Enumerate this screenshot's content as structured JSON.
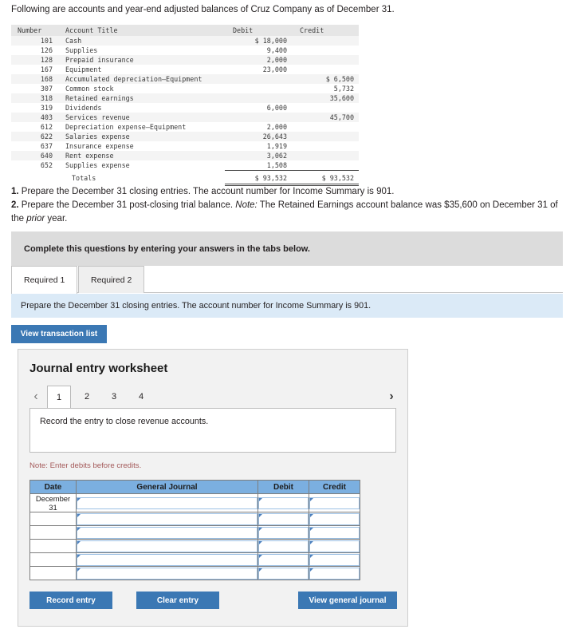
{
  "intro": "Following are accounts and year-end adjusted balances of Cruz Company as of December 31.",
  "trial_balance": {
    "headers": [
      "Number",
      "Account Title",
      "Debit",
      "Credit"
    ],
    "rows": [
      {
        "number": "101",
        "title": "Cash",
        "debit": "$ 18,000",
        "credit": ""
      },
      {
        "number": "126",
        "title": "Supplies",
        "debit": "9,400",
        "credit": ""
      },
      {
        "number": "128",
        "title": "Prepaid insurance",
        "debit": "2,000",
        "credit": ""
      },
      {
        "number": "167",
        "title": "Equipment",
        "debit": "23,000",
        "credit": ""
      },
      {
        "number": "168",
        "title": "Accumulated depreciation—Equipment",
        "debit": "",
        "credit": "$ 6,500"
      },
      {
        "number": "307",
        "title": "Common stock",
        "debit": "",
        "credit": "5,732"
      },
      {
        "number": "318",
        "title": "Retained earnings",
        "debit": "",
        "credit": "35,600"
      },
      {
        "number": "319",
        "title": "Dividends",
        "debit": "6,000",
        "credit": ""
      },
      {
        "number": "403",
        "title": "Services revenue",
        "debit": "",
        "credit": "45,700"
      },
      {
        "number": "612",
        "title": "Depreciation expense—Equipment",
        "debit": "2,000",
        "credit": ""
      },
      {
        "number": "622",
        "title": "Salaries expense",
        "debit": "26,643",
        "credit": ""
      },
      {
        "number": "637",
        "title": "Insurance expense",
        "debit": "1,919",
        "credit": ""
      },
      {
        "number": "640",
        "title": "Rent expense",
        "debit": "3,062",
        "credit": ""
      },
      {
        "number": "652",
        "title": "Supplies expense",
        "debit": "1,508",
        "credit": ""
      }
    ],
    "totals": {
      "number": "",
      "title": "Totals",
      "debit": "$ 93,532",
      "credit": "$ 93,532"
    }
  },
  "requirements": {
    "num1": "1.",
    "text1": " Prepare the December 31 closing entries. The account number for Income Summary is 901.",
    "num2": "2.",
    "text2a": " Prepare the December 31 post-closing trial balance. ",
    "note_italic": "Note:",
    "text2b": " The Retained Earnings account balance was $35,600 on December 31 of the ",
    "prior_italic": "prior",
    "text2c": " year."
  },
  "banner": {
    "text": "Complete this questions by entering your answers in the tabs below."
  },
  "tabs": [
    {
      "label": "Required 1",
      "active": true
    },
    {
      "label": "Required 2",
      "active": false
    }
  ],
  "blue_prompt": "Prepare the December 31 closing entries. The account number for Income Summary is 901.",
  "view_transaction_list_label": "View transaction list",
  "worksheet": {
    "title": "Journal entry worksheet",
    "prev_icon": "chevron-left",
    "next_icon": "chevron-right",
    "pages": [
      "1",
      "2",
      "3",
      "4"
    ],
    "selected_page": "1",
    "task": "Record the entry to close revenue accounts.",
    "note": "Note: Enter debits before credits.",
    "journal": {
      "headers": [
        "Date",
        "General Journal",
        "Debit",
        "Credit"
      ],
      "rows": [
        {
          "date_line1": "December",
          "date_line2": "31",
          "general_journal": "",
          "debit": "",
          "credit": ""
        },
        {
          "date_line1": "",
          "date_line2": "",
          "general_journal": "",
          "debit": "",
          "credit": ""
        },
        {
          "date_line1": "",
          "date_line2": "",
          "general_journal": "",
          "debit": "",
          "credit": ""
        },
        {
          "date_line1": "",
          "date_line2": "",
          "general_journal": "",
          "debit": "",
          "credit": ""
        },
        {
          "date_line1": "",
          "date_line2": "",
          "general_journal": "",
          "debit": "",
          "credit": ""
        },
        {
          "date_line1": "",
          "date_line2": "",
          "general_journal": "",
          "debit": "",
          "credit": ""
        }
      ]
    },
    "buttons": {
      "record": "Record entry",
      "clear": "Clear entry",
      "view_journal": "View general journal"
    }
  },
  "colors": {
    "button_blue": "#3b78b4",
    "table_header_blue": "#7bafe0",
    "info_bar_blue": "#dbeaf7",
    "banner_gray": "#dcdcdc",
    "note_red": "#a45a5a"
  }
}
